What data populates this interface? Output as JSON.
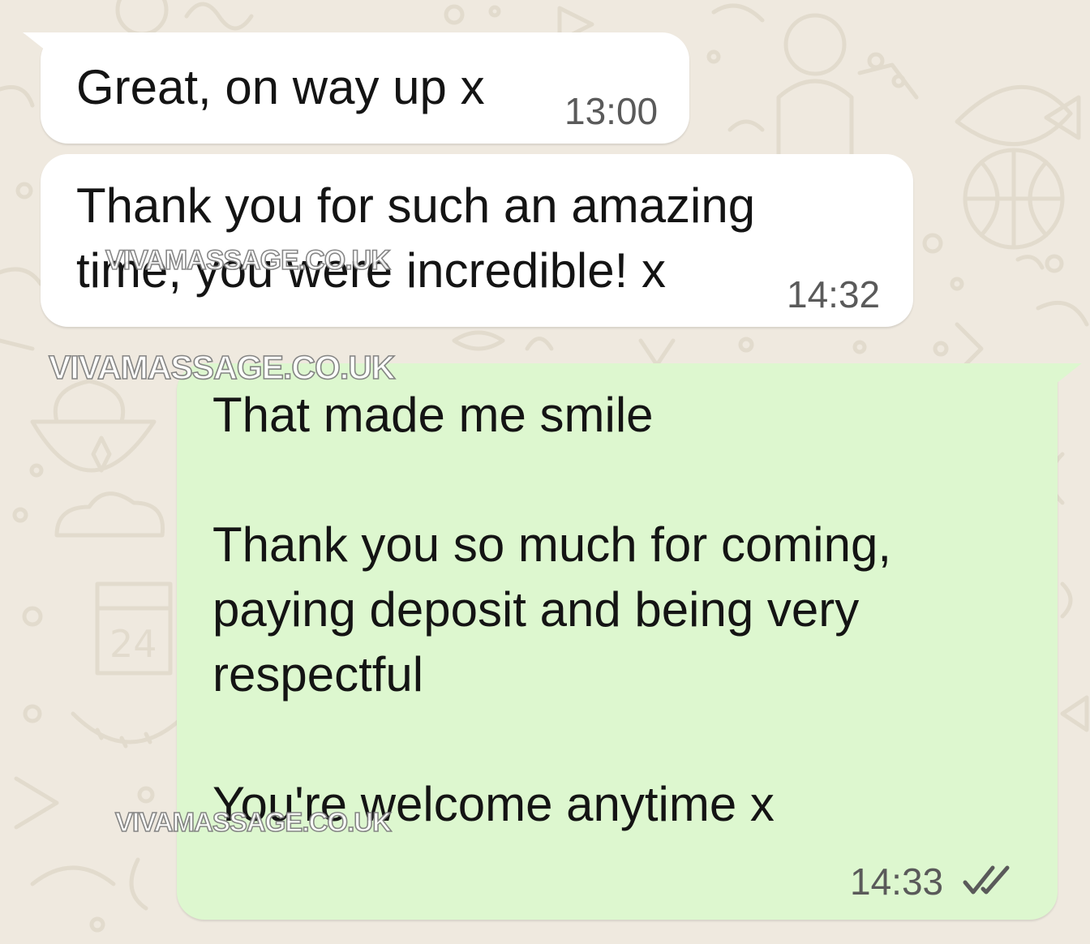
{
  "chat": {
    "messages": [
      {
        "direction": "incoming",
        "text": "Great, on way up x",
        "time": "13:00"
      },
      {
        "direction": "incoming",
        "text": "Thank you for such an amazing\ntime, you were incredible! x",
        "time": "14:32"
      },
      {
        "direction": "outgoing",
        "text": "That made me smile\n\nThank you so much for coming,\npaying deposit and being very\nrespectful\n\nYou're welcome anytime x",
        "time": "14:33",
        "status": "read"
      }
    ]
  },
  "watermarks": [
    {
      "text": "VIVAMASSAGE.CO.UK"
    },
    {
      "text": "VIVAMASSAGE.CO.UK"
    },
    {
      "text": "VIVAMASSAGE.CO.UK"
    }
  ],
  "icons": {
    "read_receipt": "double-check-icon"
  },
  "colors": {
    "background": "#efe9df",
    "incoming_bubble": "#ffffff",
    "outgoing_bubble": "#ddf7cf",
    "text": "#141414",
    "timestamp": "#5a5a5a"
  }
}
